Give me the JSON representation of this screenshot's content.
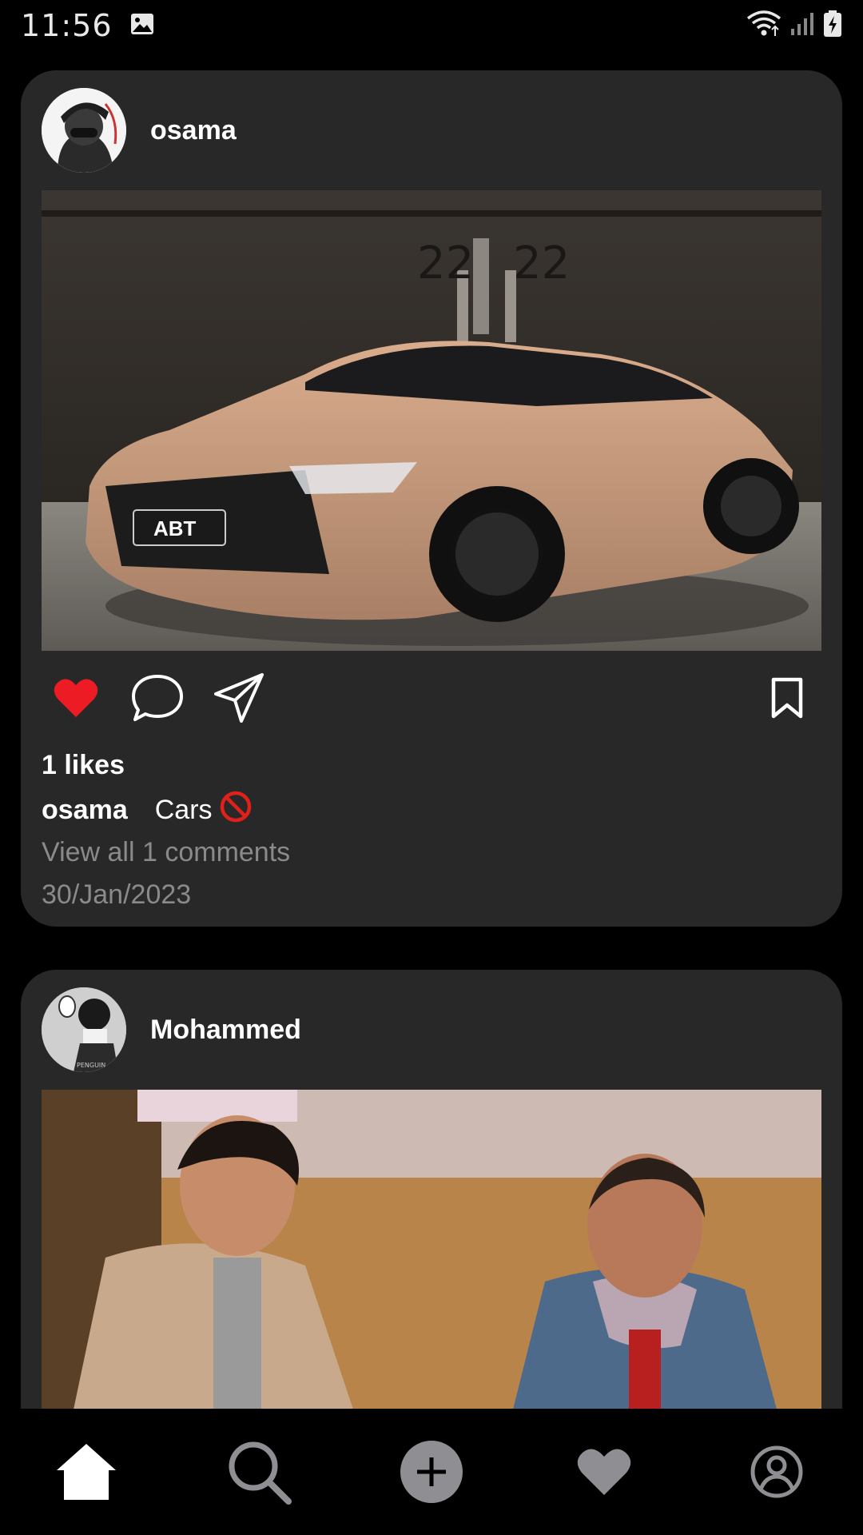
{
  "status_bar": {
    "time": "11:56",
    "icons": [
      "image-icon",
      "wifi-icon",
      "signal-icon",
      "battery-charging-icon"
    ]
  },
  "posts": [
    {
      "username": "osama",
      "avatar": "avatar-masked-figure",
      "image": "photo-tan-sports-car",
      "liked": true,
      "likes_label": "1 likes",
      "caption_user": "osama",
      "caption_text": "Cars",
      "caption_emoji": "🚫",
      "view_comments": "View all 1 comments",
      "date": "30/Jan/2023"
    },
    {
      "username": "Mohammed",
      "avatar": "avatar-anime-character",
      "image": "photo-two-men-scene"
    }
  ],
  "bottom_nav": {
    "items": [
      "home-icon",
      "search-icon",
      "add-icon",
      "heart-icon",
      "profile-icon"
    ],
    "active": "home-icon"
  },
  "colors": {
    "background": "#000000",
    "card": "#282828",
    "like_red": "#ED1C24",
    "muted_text": "#8A8A8A",
    "nav_inactive": "#8E8E93"
  }
}
